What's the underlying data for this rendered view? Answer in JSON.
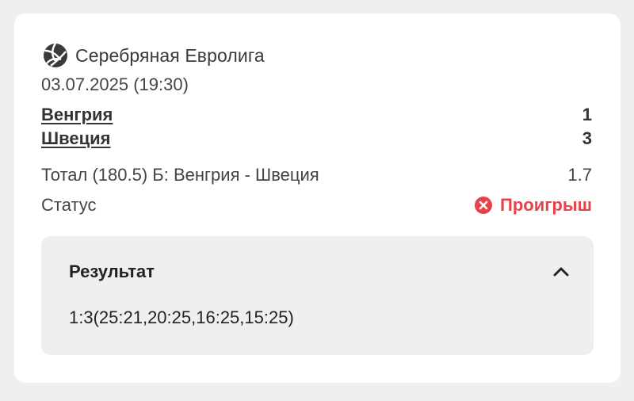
{
  "league": {
    "icon": "volleyball-icon",
    "name": "Серебряная Евролига"
  },
  "match": {
    "datetime": "03.07.2025 (19:30)",
    "home_team": "Венгрия",
    "away_team": "Швеция",
    "home_score": "1",
    "away_score": "3"
  },
  "bet": {
    "description": "Тотал (180.5) Б: Венгрия - Швеция",
    "odds": "1.7"
  },
  "status": {
    "label": "Статус",
    "value": "Проигрыш",
    "icon": "close-circle-icon",
    "color": "#e84148"
  },
  "result": {
    "title": "Результат",
    "value": "1:3(25:21,20:25,16:25,15:25)",
    "toggle_icon": "chevron-up-icon"
  }
}
